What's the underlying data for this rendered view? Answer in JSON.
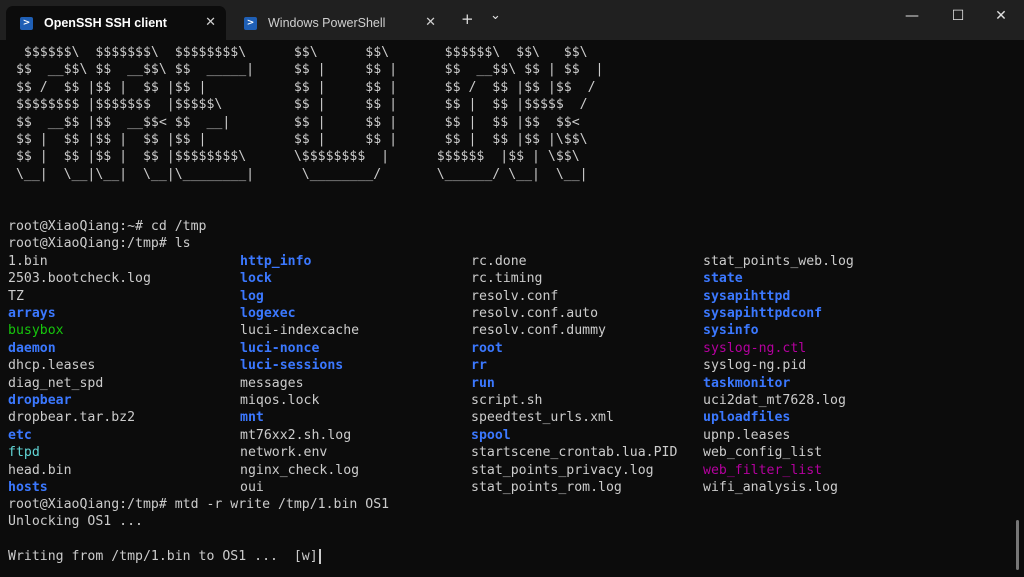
{
  "window": {
    "tabs": [
      {
        "label": "OpenSSH SSH client",
        "active": true
      },
      {
        "label": "Windows PowerShell",
        "active": false
      }
    ],
    "new_tab": "+",
    "dropdown": "⌄",
    "minimize": "—",
    "maximize": "☐",
    "close": "✕",
    "tab_close": "✕"
  },
  "banner": "  $$$$$$\\  $$$$$$$\\  $$$$$$$$\\      $$\\      $$\\       $$$$$$\\  $$\\   $$\\\n $$  __$$\\ $$  __$$\\ $$  _____|     $$ |     $$ |      $$  __$$\\ $$ | $$  |\n $$ /  $$ |$$ |  $$ |$$ |           $$ |     $$ |      $$ /  $$ |$$ |$$  /\n $$$$$$$$ |$$$$$$$  |$$$$$\\         $$ |     $$ |      $$ |  $$ |$$$$$  /\n $$  __$$ |$$  __$$< $$  __|        $$ |     $$ |      $$ |  $$ |$$  $$<\n $$ |  $$ |$$ |  $$ |$$ |           $$ |     $$ |      $$ |  $$ |$$ |\\$$\\\n $$ |  $$ |$$ |  $$ |$$$$$$$$\\      \\$$$$$$$$  |      $$$$$$  |$$ | \\$$\\\n \\__|  \\__|\\__|  \\__|\\________|      \\________/       \\______/ \\__|  \\__|",
  "prompt1": "root@XiaoQiang:~# cd /tmp",
  "prompt2": "root@XiaoQiang:/tmp# ls",
  "ls_columns": [
    [
      {
        "name": "1.bin",
        "type": "file"
      },
      {
        "name": "2503.bootcheck.log",
        "type": "file"
      },
      {
        "name": "TZ",
        "type": "file"
      },
      {
        "name": "arrays",
        "type": "dir"
      },
      {
        "name": "busybox",
        "type": "exe"
      },
      {
        "name": "daemon",
        "type": "dir"
      },
      {
        "name": "dhcp.leases",
        "type": "file"
      },
      {
        "name": "diag_net_spd",
        "type": "file"
      },
      {
        "name": "dropbear",
        "type": "dir"
      },
      {
        "name": "dropbear.tar.bz2",
        "type": "file"
      },
      {
        "name": "etc",
        "type": "dir"
      },
      {
        "name": "ftpd",
        "type": "cyan"
      },
      {
        "name": "head.bin",
        "type": "file"
      },
      {
        "name": "hosts",
        "type": "dir"
      }
    ],
    [
      {
        "name": "http_info",
        "type": "dir"
      },
      {
        "name": "lock",
        "type": "dir"
      },
      {
        "name": "log",
        "type": "dir"
      },
      {
        "name": "logexec",
        "type": "dir"
      },
      {
        "name": "luci-indexcache",
        "type": "file"
      },
      {
        "name": "luci-nonce",
        "type": "dir"
      },
      {
        "name": "luci-sessions",
        "type": "dir"
      },
      {
        "name": "messages",
        "type": "file"
      },
      {
        "name": "miqos.lock",
        "type": "file"
      },
      {
        "name": "mnt",
        "type": "dir"
      },
      {
        "name": "mt76xx2.sh.log",
        "type": "file"
      },
      {
        "name": "network.env",
        "type": "file"
      },
      {
        "name": "nginx_check.log",
        "type": "file"
      },
      {
        "name": "oui",
        "type": "file"
      }
    ],
    [
      {
        "name": "rc.done",
        "type": "file"
      },
      {
        "name": "rc.timing",
        "type": "file"
      },
      {
        "name": "resolv.conf",
        "type": "file"
      },
      {
        "name": "resolv.conf.auto",
        "type": "file"
      },
      {
        "name": "resolv.conf.dummy",
        "type": "file"
      },
      {
        "name": "root",
        "type": "dir"
      },
      {
        "name": "rr",
        "type": "dir"
      },
      {
        "name": "run",
        "type": "dir"
      },
      {
        "name": "script.sh",
        "type": "file"
      },
      {
        "name": "speedtest_urls.xml",
        "type": "file"
      },
      {
        "name": "spool",
        "type": "dir"
      },
      {
        "name": "startscene_crontab.lua.PID",
        "type": "file"
      },
      {
        "name": "stat_points_privacy.log",
        "type": "file"
      },
      {
        "name": "stat_points_rom.log",
        "type": "file"
      }
    ],
    [
      {
        "name": "stat_points_web.log",
        "type": "file"
      },
      {
        "name": "state",
        "type": "dir"
      },
      {
        "name": "sysapihttpd",
        "type": "dir"
      },
      {
        "name": "sysapihttpdconf",
        "type": "dir"
      },
      {
        "name": "sysinfo",
        "type": "dir"
      },
      {
        "name": "syslog-ng.ctl",
        "type": "magenta"
      },
      {
        "name": "syslog-ng.pid",
        "type": "file"
      },
      {
        "name": "taskmonitor",
        "type": "dir"
      },
      {
        "name": "uci2dat_mt7628.log",
        "type": "file"
      },
      {
        "name": "uploadfiles",
        "type": "dir"
      },
      {
        "name": "upnp.leases",
        "type": "file"
      },
      {
        "name": "web_config_list",
        "type": "file"
      },
      {
        "name": "web_filter_list",
        "type": "magenta"
      },
      {
        "name": "wifi_analysis.log",
        "type": "file"
      }
    ]
  ],
  "prompt3": "root@XiaoQiang:/tmp# mtd -r write /tmp/1.bin OS1",
  "unlock_line": "Unlocking OS1 ...",
  "writing_line": "Writing from /tmp/1.bin to OS1 ...  [w]"
}
